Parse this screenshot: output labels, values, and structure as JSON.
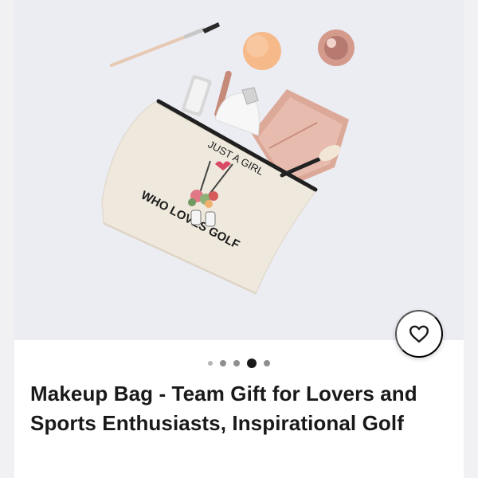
{
  "listing": {
    "title": "Makeup Bag - Team Gift for Lovers and Sports Enthusiasts, Inspirational Golf",
    "favorite_icon": "heart-outline-icon"
  },
  "gallery": {
    "total_images": 5,
    "active_index": 3
  },
  "product_print": {
    "top_text": "JUST A GIRL",
    "bottom_text": "WHO LOVES GOLF"
  },
  "colors": {
    "background": "#f1f1f4",
    "photo_background": "#ebebf2",
    "card": "#ffffff",
    "text": "#191919",
    "bag": "#efe9dd",
    "wallet": "#dca898"
  }
}
